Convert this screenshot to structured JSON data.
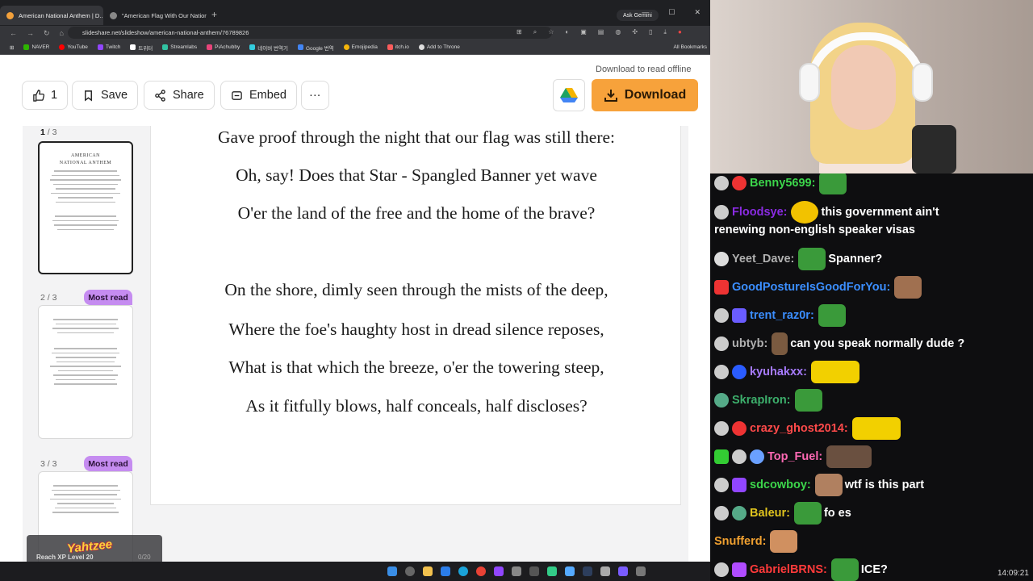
{
  "browser": {
    "tabs": [
      {
        "title": "American National Anthem | D..."
      },
      {
        "title": "\"American Flag With Our Nation..."
      }
    ],
    "ask_gemini": "Ask Gemini",
    "url": "slideshare.net/slideshow/american-national-anthem/76789826",
    "bookmarks": [
      "NAVER",
      "YouTube",
      "Twitch",
      "트위터",
      "Streamlabs",
      "PiAchubby",
      "네이버 번역기",
      "Google 번역",
      "Emojipedia",
      "itch.io",
      "Add to Throne"
    ],
    "all_bookmarks": "All Bookmarks"
  },
  "toolbar": {
    "download_note": "Download to read offline",
    "like_count": "1",
    "save_label": "Save",
    "share_label": "Share",
    "embed_label": "Embed",
    "more_label": "···",
    "download_label": "Download"
  },
  "thumbnails": [
    {
      "page": "1",
      "total": " / 3",
      "title1": "AMERICAN",
      "title2": "NATIONAL ANTHEM",
      "badge": ""
    },
    {
      "page": "2 / 3",
      "badge": "Most read"
    },
    {
      "page": "3 / 3",
      "badge": "Most read"
    }
  ],
  "document": {
    "lines": [
      "Gave proof through the night that our flag was still there:",
      "Oh, say! Does that Star - Spangled Banner yet wave",
      "O'er the land of the free and the home of the brave?",
      "On the shore, dimly seen through the mists of the deep,",
      "Where the foe's haughty host in dread silence reposes,",
      "What is that which the breeze, o'er the towering steep,",
      "As it fitfully blows, half conceals, half discloses?"
    ]
  },
  "overlay": {
    "logo": "Yahtzee",
    "xp_label": "Reach XP Level 20",
    "xp_value": "0/20",
    "xp_progress": 0
  },
  "chat": [
    {
      "user": "Benny5699:",
      "color": "#3cd64b",
      "text": ""
    },
    {
      "user": "Floodsye:",
      "color": "#8a2be2",
      "text": "this government ain't"
    },
    {
      "user": "",
      "color": "#ffffff",
      "text": "renewing non-english speaker visas"
    },
    {
      "user": "Yeet_Dave:",
      "color": "#b0b0b0",
      "text": "Spanner?"
    },
    {
      "user": "GoodPostureIsGoodForYou:",
      "color": "#3b8eff",
      "text": ""
    },
    {
      "user": "trent_raz0r:",
      "color": "#3b8eff",
      "text": ""
    },
    {
      "user": "ubtyb:",
      "color": "#b0b0b0",
      "text": "can you speak normally dude ?"
    },
    {
      "user": "kyuhakxx:",
      "color": "#a77bff",
      "text": ""
    },
    {
      "user": "SkrapIron:",
      "color": "#3cae6b",
      "text": ""
    },
    {
      "user": "crazy_ghost2014:",
      "color": "#ff4a4a",
      "text": ""
    },
    {
      "user": "Top_Fuel:",
      "color": "#ff69b4",
      "text": ""
    },
    {
      "user": "sdcowboy:",
      "color": "#3cd64b",
      "text": "wtf is this part"
    },
    {
      "user": "Baleur:",
      "color": "#e0c41e",
      "text": "fo es"
    },
    {
      "user": "Snufferd:",
      "color": "#f0a030",
      "text": ""
    },
    {
      "user": "GabrielBRNS:",
      "color": "#ff3a3a",
      "text": "ICE?"
    }
  ],
  "clock": "14:09:21",
  "colors": {
    "accent": "#f7a23b",
    "most_read": "#c58cf0",
    "chat_bg": "#0e0e10"
  }
}
